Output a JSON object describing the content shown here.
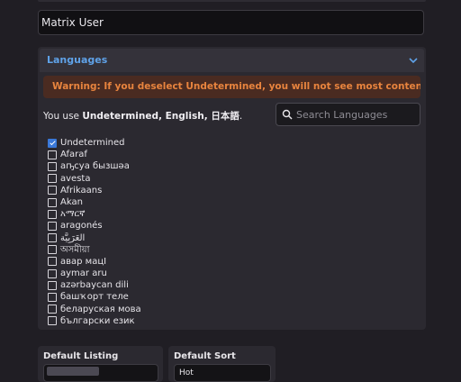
{
  "profile": {
    "display_name_value": "Matrix User"
  },
  "languages": {
    "title": "Languages",
    "warning": "Warning: If you deselect Undetermined, you will not see most content.",
    "you_use_prefix": "You use ",
    "you_use_value": "Undetermined, English, 日本語",
    "you_use_suffix": ".",
    "search_placeholder": "Search Languages",
    "items": [
      {
        "label": "Undetermined",
        "checked": true
      },
      {
        "label": "Afaraf",
        "checked": false
      },
      {
        "label": "аҧсуа бызшәа",
        "checked": false
      },
      {
        "label": "avesta",
        "checked": false
      },
      {
        "label": "Afrikaans",
        "checked": false
      },
      {
        "label": "Akan",
        "checked": false
      },
      {
        "label": "አማርኛ",
        "checked": false
      },
      {
        "label": "aragonés",
        "checked": false
      },
      {
        "label": "العَرَبِيَّة",
        "checked": false
      },
      {
        "label": "অসমীয়া",
        "checked": false
      },
      {
        "label": "авар мацӀ",
        "checked": false
      },
      {
        "label": "aymar aru",
        "checked": false
      },
      {
        "label": "azərbaycan dili",
        "checked": false
      },
      {
        "label": "башҡорт теле",
        "checked": false
      },
      {
        "label": "беларуская мова",
        "checked": false
      },
      {
        "label": "български език",
        "checked": false
      }
    ]
  },
  "default_listing": {
    "label": "Default Listing"
  },
  "default_sort": {
    "label": "Default Sort",
    "value": "Hot"
  },
  "colors": {
    "accent": "#5fa2e8",
    "warning_text": "#e8843e",
    "warning_bg": "#4a2b21",
    "checkbox": "#3a78d8"
  },
  "icons": {
    "collapse": "chevron-down-icon",
    "search": "search-icon"
  }
}
